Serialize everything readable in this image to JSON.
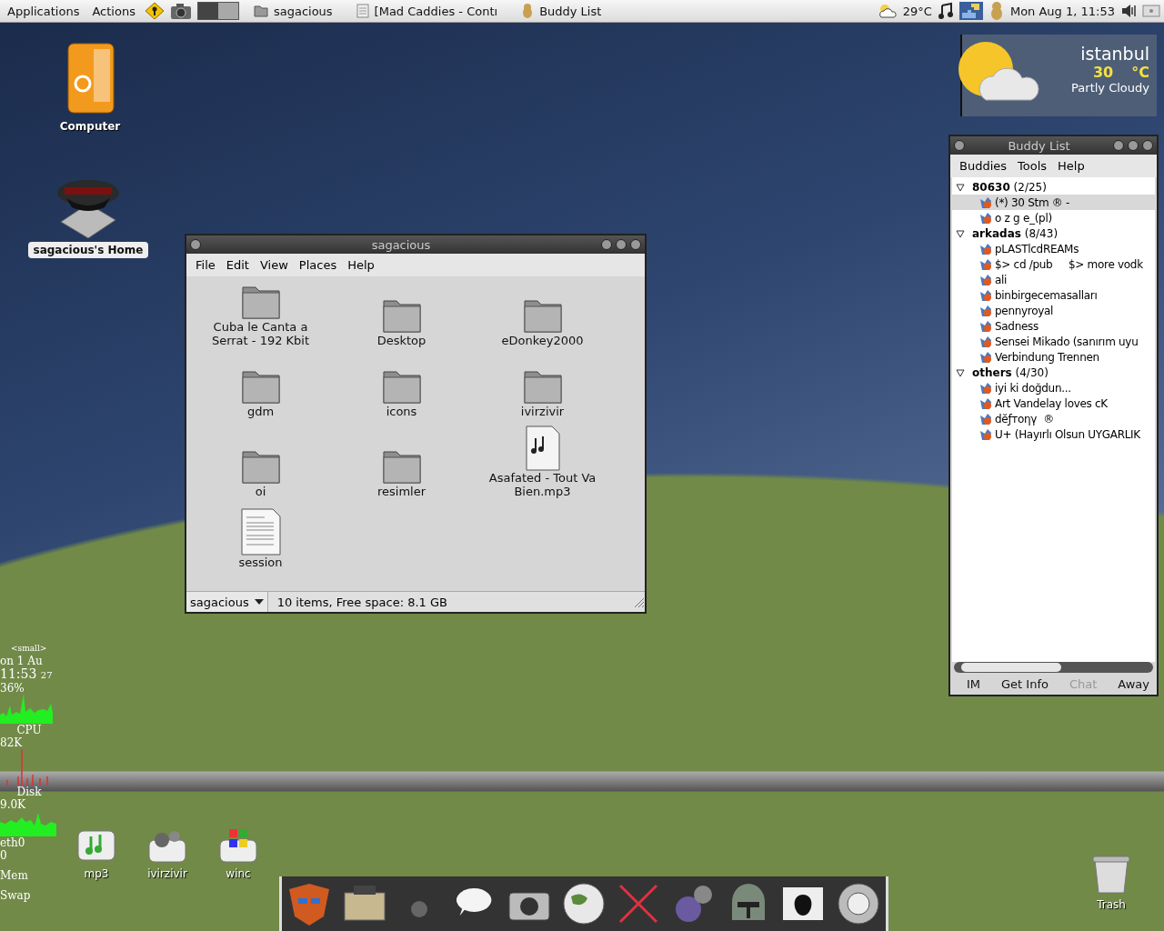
{
  "top_panel": {
    "menus": [
      "Applications",
      "Actions"
    ],
    "tasks": [
      {
        "label": "sagacious",
        "kind": "folder"
      },
      {
        "label": "[Mad Caddies - Contı",
        "kind": "document"
      },
      {
        "label": "Buddy List",
        "kind": "buddy"
      }
    ],
    "weather": "29°C",
    "clock": "Mon Aug  1, 11:53"
  },
  "desktop_icons": [
    {
      "label": "Computer",
      "kind": "computer",
      "selected": false
    },
    {
      "label": "sagacious's Home",
      "kind": "home",
      "selected": true
    }
  ],
  "weather_widget": {
    "city": "istanbul",
    "temperature": "30",
    "unit": "°C",
    "condition": "Partly Cloudy"
  },
  "file_manager": {
    "title": "sagacious",
    "menus": [
      "File",
      "Edit",
      "View",
      "Places",
      "Help"
    ],
    "items": [
      {
        "label": "Cuba le Canta a Serrat - 192 Kbit",
        "kind": "folder"
      },
      {
        "label": "Desktop",
        "kind": "folder"
      },
      {
        "label": "eDonkey2000",
        "kind": "folder"
      },
      {
        "label": "gdm",
        "kind": "folder"
      },
      {
        "label": "icons",
        "kind": "folder"
      },
      {
        "label": "ivirzivir",
        "kind": "folder"
      },
      {
        "label": "oi",
        "kind": "folder"
      },
      {
        "label": "resimler",
        "kind": "folder"
      },
      {
        "label": "Asafated - Tout Va Bien.mp3",
        "kind": "audio"
      },
      {
        "label": "session",
        "kind": "document"
      }
    ],
    "location": "sagacious",
    "status": "10 items, Free space: 8.1 GB"
  },
  "buddy_list": {
    "title": "Buddy List",
    "menus": [
      "Buddies",
      "Tools",
      "Help"
    ],
    "groups": [
      {
        "name": "80630",
        "count": "(2/25)",
        "expanded": true,
        "children": [
          {
            "name": "(*) 30 Stm ® -",
            "selected": true
          },
          {
            "name": "o z g e_(pl)",
            "selected": false
          }
        ]
      },
      {
        "name": "arkadas",
        "count": "(8/43)",
        "expanded": true,
        "children": [
          {
            "name": "pLASTlcdREAMs",
            "selected": false
          },
          {
            "name": "$> cd /pub     $> more vodk",
            "selected": false
          },
          {
            "name": "ali",
            "selected": false
          },
          {
            "name": "binbirgecemasalları",
            "selected": false
          },
          {
            "name": "pennyroyal",
            "selected": false
          },
          {
            "name": "Sadness",
            "selected": false
          },
          {
            "name": "Sensei Mikado (sanırım uyu",
            "selected": false
          },
          {
            "name": "Verbindung Trennen",
            "selected": false
          }
        ]
      },
      {
        "name": "others",
        "count": "(4/30)",
        "expanded": true,
        "children": [
          {
            "name": "iyi ki doğdun...",
            "selected": false
          },
          {
            "name": "Art Vandelay loves cK",
            "selected": false
          },
          {
            "name": "dĕƒтoηγ  ®",
            "selected": false
          },
          {
            "name": "U+ (Hayırlı Olsun UYGARLIK",
            "selected": false
          }
        ]
      }
    ],
    "buttons": [
      {
        "label": "IM",
        "disabled": false
      },
      {
        "label": "Get Info",
        "disabled": false
      },
      {
        "label": "Chat",
        "disabled": true
      },
      {
        "label": "Away",
        "disabled": false
      }
    ]
  },
  "system_monitor": {
    "header": "<small>",
    "date": "on  1  Au",
    "time": "11:53",
    "seconds": "27",
    "cpu_reading": "36%",
    "cpu_label": "CPU",
    "disk_reading": "82K",
    "disk_label": "Disk",
    "net_reading": "9.0K",
    "net_label": "eth0",
    "net_value": "0",
    "mem_label": "Mem",
    "swap_label": "Swap"
  },
  "bottom_icons": [
    {
      "label": "mp3",
      "kind": "music"
    },
    {
      "label": "ivirzivir",
      "kind": "gears"
    },
    {
      "label": "winc",
      "kind": "windows"
    }
  ],
  "trash": {
    "label": "Trash"
  }
}
